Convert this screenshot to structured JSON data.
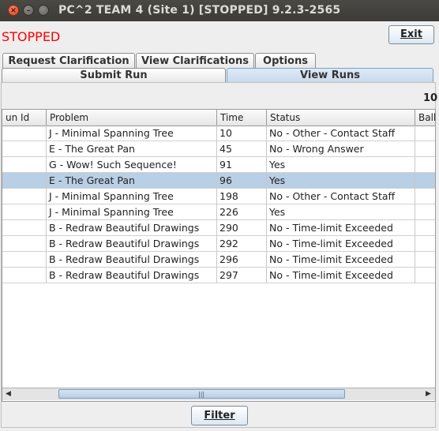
{
  "window": {
    "title": "PC^2 TEAM 4 (Site 1) [STOPPED] 9.2.3-2565"
  },
  "status": {
    "text": "STOPPED",
    "color": "#ff0000"
  },
  "exit_button": {
    "label": "Exit"
  },
  "tabs_row1": [
    {
      "label": "Request Clarification"
    },
    {
      "label": "View Clarifications"
    },
    {
      "label": "Options"
    }
  ],
  "tabs_row2": [
    {
      "label": "Submit Run",
      "selected": false
    },
    {
      "label": "View Runs",
      "selected": true
    }
  ],
  "top_count": "10",
  "table": {
    "columns": [
      "un Id",
      "Problem",
      "Time",
      "Status",
      "Ball"
    ],
    "rows": [
      {
        "problem": "J - Minimal Spanning Tree",
        "time": "10",
        "status": "No - Other - Contact Staff"
      },
      {
        "problem": "E - The Great Pan",
        "time": "45",
        "status": "No - Wrong Answer"
      },
      {
        "problem": "G - Wow! Such Sequence!",
        "time": "91",
        "status": "Yes"
      },
      {
        "problem": "E - The Great Pan",
        "time": "96",
        "status": "Yes",
        "selected": true
      },
      {
        "problem": "J - Minimal Spanning Tree",
        "time": "198",
        "status": "No - Other - Contact Staff"
      },
      {
        "problem": "J - Minimal Spanning Tree",
        "time": "226",
        "status": "Yes"
      },
      {
        "problem": "B - Redraw Beautiful Drawings",
        "time": "290",
        "status": "No - Time-limit Exceeded"
      },
      {
        "problem": "B - Redraw Beautiful Drawings",
        "time": "292",
        "status": "No - Time-limit Exceeded"
      },
      {
        "problem": "B - Redraw Beautiful Drawings",
        "time": "296",
        "status": "No - Time-limit Exceeded"
      },
      {
        "problem": "B - Redraw Beautiful Drawings",
        "time": "297",
        "status": "No - Time-limit Exceeded"
      }
    ]
  },
  "scrollbar": {
    "left_arrow": "◀",
    "right_arrow": "▶",
    "grip": "|||"
  },
  "filter_button": {
    "label": "Filter"
  }
}
